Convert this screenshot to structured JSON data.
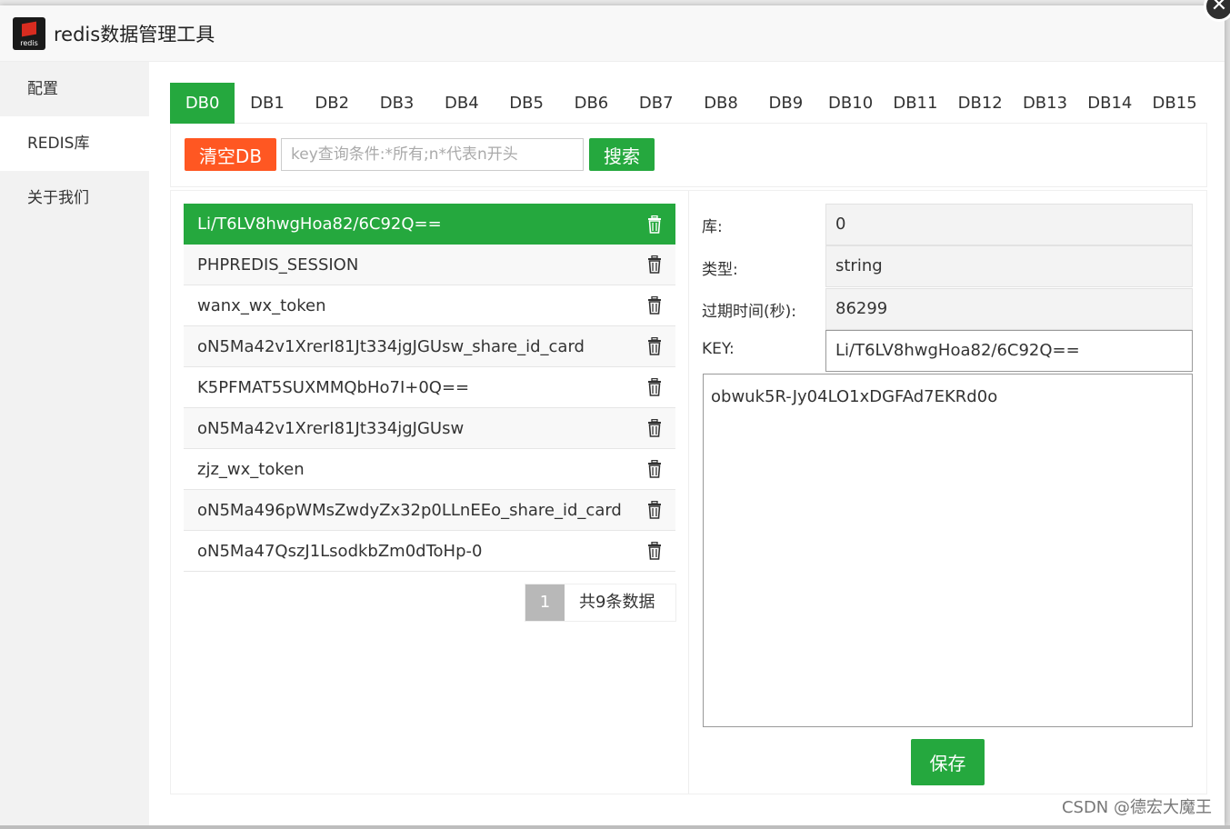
{
  "window": {
    "title": "redis数据管理工具",
    "logo_text": "redis",
    "close_glyph": "✕"
  },
  "sidebar": {
    "items": [
      {
        "label": "配置"
      },
      {
        "label": "REDIS库"
      },
      {
        "label": "关于我们"
      }
    ]
  },
  "tabs": [
    "DB0",
    "DB1",
    "DB2",
    "DB3",
    "DB4",
    "DB5",
    "DB6",
    "DB7",
    "DB8",
    "DB9",
    "DB10",
    "DB11",
    "DB12",
    "DB13",
    "DB14",
    "DB15"
  ],
  "toolbar": {
    "clear_label": "清空DB",
    "search_placeholder": "key查询条件:*所有;n*代表n开头",
    "search_label": "搜索"
  },
  "keys": [
    "Li/T6LV8hwgHoa82/6C92Q==",
    "PHPREDIS_SESSION",
    "wanx_wx_token",
    "oN5Ma42v1XrerI81Jt334jgJGUsw_share_id_card",
    "K5PFMAT5SUXMMQbHo7I+0Q==",
    "oN5Ma42v1XrerI81Jt334jgJGUsw",
    "zjz_wx_token",
    "oN5Ma496pWMsZwdyZx32p0LLnEEo_share_id_card",
    "oN5Ma47QszJ1LsodkbZm0dToHp-0"
  ],
  "pager": {
    "current": "1",
    "total": "共9条数据"
  },
  "detail": {
    "db_label": "库:",
    "db_value": "0",
    "type_label": "类型:",
    "type_value": "string",
    "ttl_label": "过期时间(秒):",
    "ttl_value": "86299",
    "key_label": "KEY:",
    "key_value": "Li/T6LV8hwgHoa82/6C92Q==",
    "value": "obwuk5R-Jy04LO1xDGFAd7EKRd0o",
    "save_label": "保存"
  },
  "watermark": "CSDN @德宏大魔王",
  "colors": {
    "accent_green": "#25a83e",
    "danger_orange": "#ff5722"
  }
}
